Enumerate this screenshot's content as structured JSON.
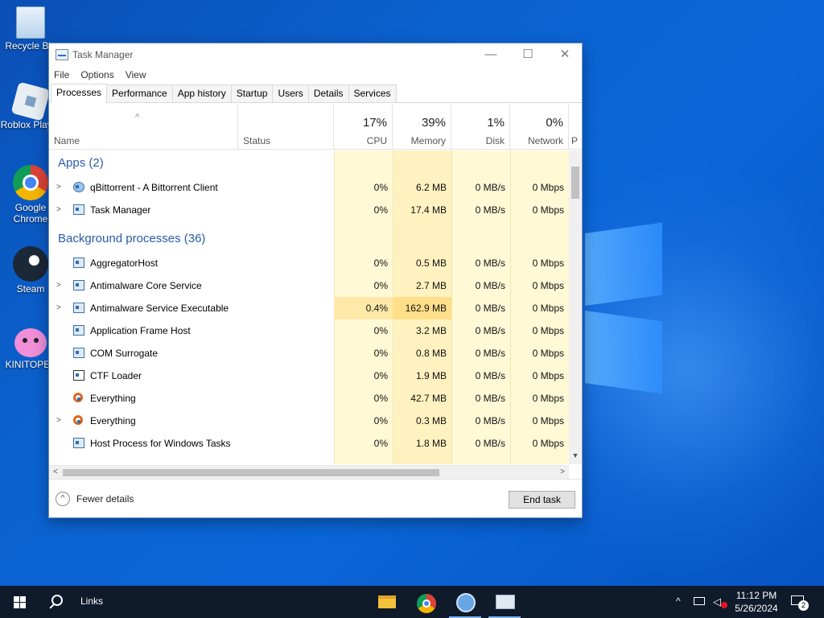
{
  "desktop": {
    "icons": [
      {
        "label": "Recycle Bin",
        "icon": "recycle-bin-icon"
      },
      {
        "label": "Roblox Player",
        "icon": "roblox-icon"
      },
      {
        "label": "Google Chrome",
        "icon": "chrome-icon"
      },
      {
        "label": "Steam",
        "icon": "steam-icon"
      },
      {
        "label": "KINITOPET",
        "icon": "kinitopet-icon"
      }
    ]
  },
  "window": {
    "title": "Task Manager",
    "controls": {
      "minimize": "—",
      "maximize": "☐",
      "close": "✕"
    }
  },
  "menu": [
    "File",
    "Options",
    "View"
  ],
  "tabs": [
    "Processes",
    "Performance",
    "App history",
    "Startup",
    "Users",
    "Details",
    "Services"
  ],
  "active_tab": "Processes",
  "columns": {
    "name": "Name",
    "status": "Status",
    "cpu": {
      "percent": "17%",
      "label": "CPU"
    },
    "memory": {
      "percent": "39%",
      "label": "Memory"
    },
    "disk": {
      "percent": "1%",
      "label": "Disk"
    },
    "network": {
      "percent": "0%",
      "label": "Network"
    },
    "extra": "P"
  },
  "groups": {
    "apps": "Apps (2)",
    "background": "Background processes (36)"
  },
  "apps": [
    {
      "name": "qBittorrent - A Bittorrent Client",
      "cpu": "0%",
      "memory": "6.2 MB",
      "disk": "0 MB/s",
      "network": "0 Mbps",
      "expandable": true
    },
    {
      "name": "Task Manager",
      "cpu": "0%",
      "memory": "17.4 MB",
      "disk": "0 MB/s",
      "network": "0 Mbps",
      "expandable": true
    }
  ],
  "background": [
    {
      "name": "AggregatorHost",
      "cpu": "0%",
      "memory": "0.5 MB",
      "disk": "0 MB/s",
      "network": "0 Mbps",
      "expandable": false
    },
    {
      "name": "Antimalware Core Service",
      "cpu": "0%",
      "memory": "2.7 MB",
      "disk": "0 MB/s",
      "network": "0 Mbps",
      "expandable": true
    },
    {
      "name": "Antimalware Service Executable",
      "cpu": "0.4%",
      "memory": "162.9 MB",
      "disk": "0 MB/s",
      "network": "0 Mbps",
      "expandable": true
    },
    {
      "name": "Application Frame Host",
      "cpu": "0%",
      "memory": "3.2 MB",
      "disk": "0 MB/s",
      "network": "0 Mbps",
      "expandable": false
    },
    {
      "name": "COM Surrogate",
      "cpu": "0%",
      "memory": "0.8 MB",
      "disk": "0 MB/s",
      "network": "0 Mbps",
      "expandable": false
    },
    {
      "name": "CTF Loader",
      "cpu": "0%",
      "memory": "1.9 MB",
      "disk": "0 MB/s",
      "network": "0 Mbps",
      "expandable": false
    },
    {
      "name": "Everything",
      "cpu": "0%",
      "memory": "42.7 MB",
      "disk": "0 MB/s",
      "network": "0 Mbps",
      "expandable": false
    },
    {
      "name": "Everything",
      "cpu": "0%",
      "memory": "0.3 MB",
      "disk": "0 MB/s",
      "network": "0 Mbps",
      "expandable": true
    },
    {
      "name": "Host Process for Windows Tasks",
      "cpu": "0%",
      "memory": "1.8 MB",
      "disk": "0 MB/s",
      "network": "0 Mbps",
      "expandable": false
    }
  ],
  "footer": {
    "fewer_details": "Fewer details",
    "end_task": "End task"
  },
  "taskbar": {
    "search_label": "Links",
    "apps": [
      "file-explorer-icon",
      "chrome-icon",
      "qbittorrent-icon",
      "task-manager-icon"
    ],
    "time": "11:12 PM",
    "date": "5/26/2024",
    "notification_count": "2"
  }
}
